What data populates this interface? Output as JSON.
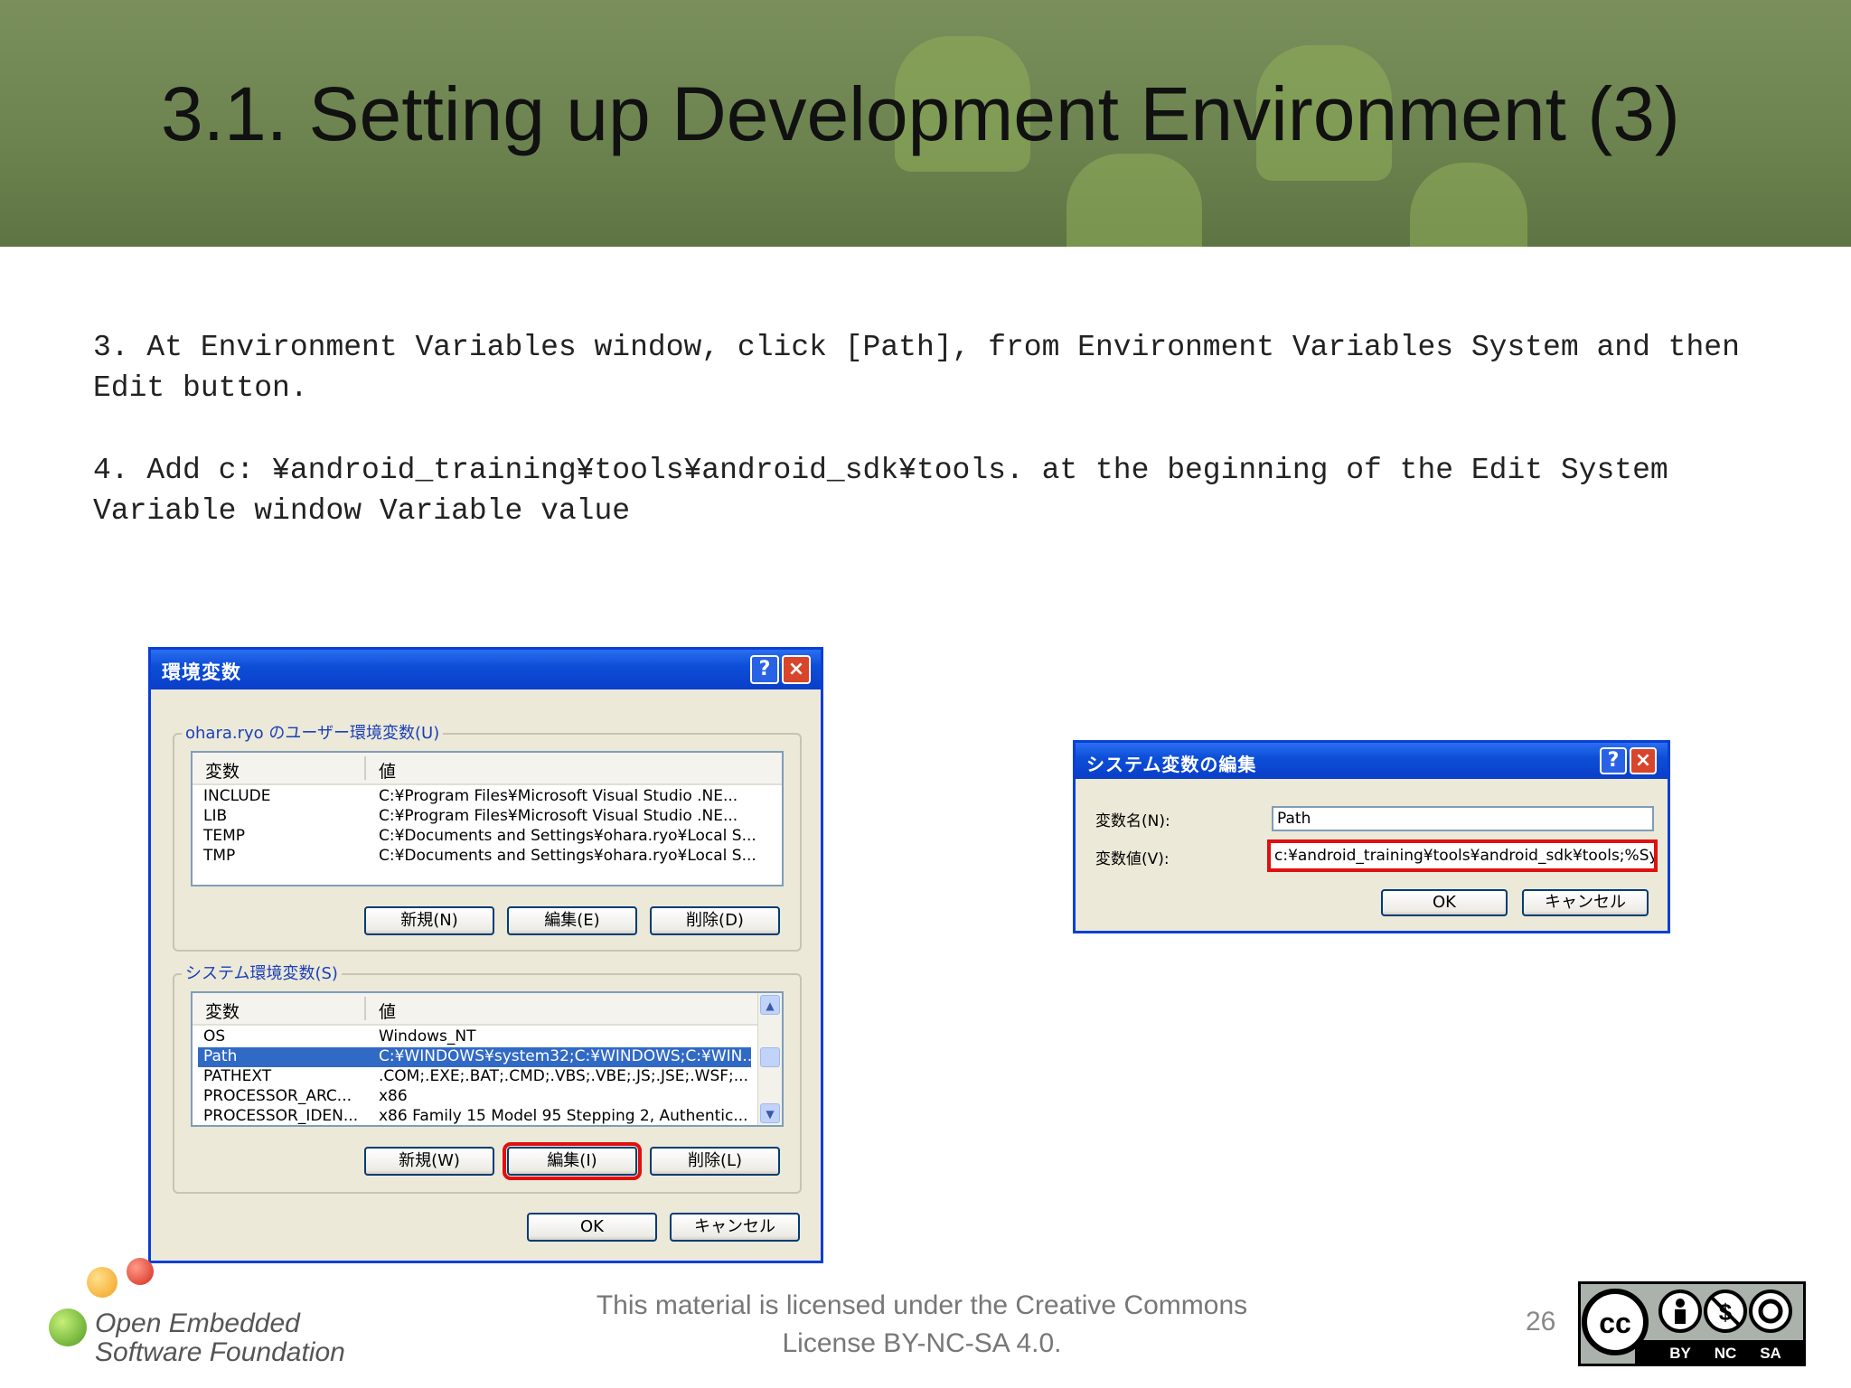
{
  "slide": {
    "title": "3.1. Setting up Development Environment (3)",
    "step3": "3. At Environment Variables window, click [Path], from Environment Variables System and then Edit button.",
    "step4": "4. Add c: ¥android_training¥tools¥android_sdk¥tools. at the beginning of the Edit System Variable window Variable value",
    "license": "This material is licensed under the Creative Commons License BY-NC-SA 4.0.",
    "page_number": "26",
    "logo_line1": "Open Embedded",
    "logo_line2": "Software Foundation",
    "cc_badges": [
      "BY",
      "NC",
      "SA"
    ]
  },
  "env_dialog": {
    "title": "環境変数",
    "help_label": "?",
    "close_label": "×",
    "user_group_label": "ohara.ryo のユーザー環境変数(U)",
    "col_var": "変数",
    "col_val": "値",
    "user_vars": [
      {
        "name": "INCLUDE",
        "value": "C:¥Program Files¥Microsoft Visual Studio .NE..."
      },
      {
        "name": "LIB",
        "value": "C:¥Program Files¥Microsoft Visual Studio .NE..."
      },
      {
        "name": "TEMP",
        "value": "C:¥Documents and Settings¥ohara.ryo¥Local S..."
      },
      {
        "name": "TMP",
        "value": "C:¥Documents and Settings¥ohara.ryo¥Local S..."
      }
    ],
    "user_buttons": {
      "new": "新規(N)",
      "edit": "編集(E)",
      "delete": "削除(D)"
    },
    "system_group_label": "システム環境変数(S)",
    "system_vars": [
      {
        "name": "OS",
        "value": "Windows_NT"
      },
      {
        "name": "Path",
        "value": "C:¥WINDOWS¥system32;C:¥WINDOWS;C:¥WIN..."
      },
      {
        "name": "PATHEXT",
        "value": ".COM;.EXE;.BAT;.CMD;.VBS;.VBE;.JS;.JSE;.WSF;..."
      },
      {
        "name": "PROCESSOR_ARC...",
        "value": "x86"
      },
      {
        "name": "PROCESSOR_IDEN...",
        "value": "x86 Family 15 Model 95 Stepping 2, Authentic..."
      }
    ],
    "system_buttons": {
      "new": "新規(W)",
      "edit": "編集(I)",
      "delete": "削除(L)"
    },
    "ok": "OK",
    "cancel": "キャンセル",
    "scroll_up": "▲",
    "scroll_down": "▼"
  },
  "edit_dialog": {
    "title": "システム変数の編集",
    "help_label": "?",
    "close_label": "×",
    "name_label": "変数名(N):",
    "name_value": "Path",
    "value_label": "変数値(V):",
    "value_value": "c:¥android_training¥tools¥android_sdk¥tools;%Sys",
    "ok": "OK",
    "cancel": "キャンセル"
  },
  "colors": {
    "titlebar": "#0a3ec8",
    "highlight": "#e01010",
    "selection": "#316ac5",
    "dialog_bg": "#ece9d8"
  }
}
